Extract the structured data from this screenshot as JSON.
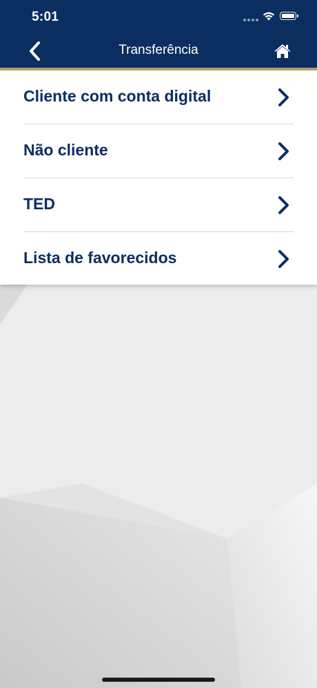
{
  "status_bar": {
    "time": "5:01"
  },
  "header": {
    "title": "Transferência",
    "back_icon": "chevron-left-icon",
    "home_icon": "home-icon"
  },
  "menu": {
    "items": [
      {
        "label": "Cliente com conta digital"
      },
      {
        "label": "Não cliente"
      },
      {
        "label": "TED"
      },
      {
        "label": "Lista de favorecidos"
      }
    ]
  },
  "colors": {
    "brand_navy": "#0b2e61",
    "accent_gold": "#b59a6b",
    "card_bg": "#ffffff",
    "divider": "#d4d4d4"
  }
}
